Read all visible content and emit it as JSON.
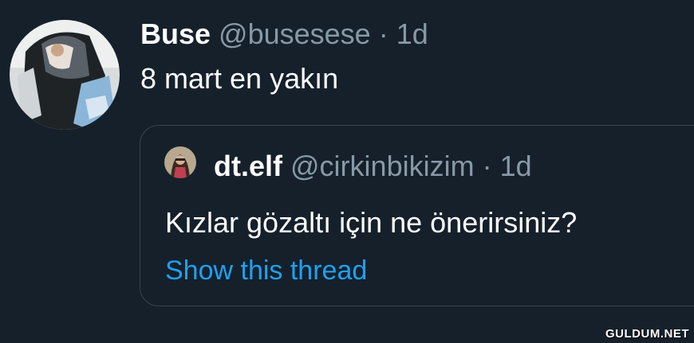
{
  "tweet": {
    "display_name": "Buse",
    "handle": "@busesese",
    "separator": "·",
    "time": "1d",
    "text": "8 mart en yakın"
  },
  "quoted_tweet": {
    "display_name": "dt.elf",
    "handle": "@cirkinbikizim",
    "separator": "·",
    "time": "1d",
    "text": "Kızlar gözaltı için ne önerirsiniz?",
    "show_thread_label": "Show this thread"
  },
  "watermark": "GULDUM.NET",
  "colors": {
    "background": "#15202b",
    "primary_text": "#ffffff",
    "secondary_text": "#8899a6",
    "link": "#1da1f2",
    "border": "#38444d"
  },
  "icons": {
    "author_avatar": "profile-photo",
    "quoted_avatar": "profile-photo"
  }
}
